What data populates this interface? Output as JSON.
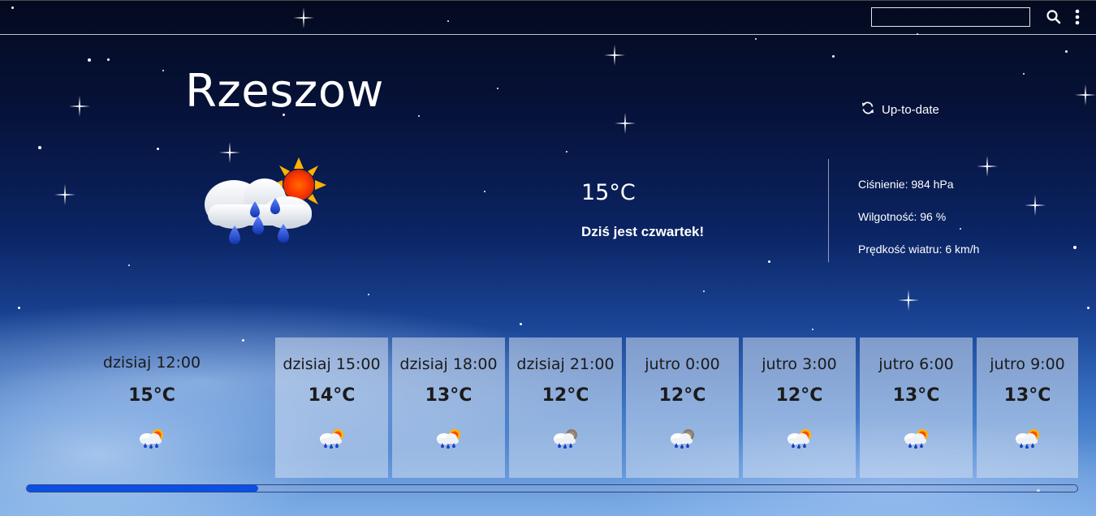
{
  "header": {
    "search": {
      "value": "",
      "placeholder": ""
    },
    "search_icon": "search-icon",
    "menu_icon": "kebab-menu-icon"
  },
  "location": {
    "city": "Rzeszow"
  },
  "status": {
    "update_label": "Up-to-date",
    "icon": "refresh-icon"
  },
  "current": {
    "icon": "cloud-rain-sun-icon",
    "temperature": "15°C",
    "day_text": "Dziś jest czwartek!"
  },
  "details": {
    "pressure": "Ciśnienie: 984 hPa",
    "humidity": "Wilgotność: 96 %",
    "wind": "Prędkość wiatru: 6 km/h"
  },
  "forecast": [
    {
      "time": "dzisiaj 12:00",
      "temp": "15°C",
      "icon": "cloud-rain-sun-icon",
      "selected": true
    },
    {
      "time": "dzisiaj 15:00",
      "temp": "14°C",
      "icon": "cloud-rain-sun-icon"
    },
    {
      "time": "dzisiaj 18:00",
      "temp": "13°C",
      "icon": "cloud-rain-sun-icon"
    },
    {
      "time": "dzisiaj 21:00",
      "temp": "12°C",
      "icon": "cloud-rain-moon-icon"
    },
    {
      "time": "jutro 0:00",
      "temp": "12°C",
      "icon": "cloud-rain-moon-icon"
    },
    {
      "time": "jutro 3:00",
      "temp": "12°C",
      "icon": "cloud-rain-sun-icon"
    },
    {
      "time": "jutro 6:00",
      "temp": "13°C",
      "icon": "cloud-rain-sun-icon"
    },
    {
      "time": "jutro 9:00",
      "temp": "13°C",
      "icon": "cloud-rain-sun-icon"
    }
  ],
  "scroll": {
    "position_fraction": 0.22
  },
  "colors": {
    "progress_fill": "#0a4fe6",
    "accent_sun": "#ffb300"
  }
}
